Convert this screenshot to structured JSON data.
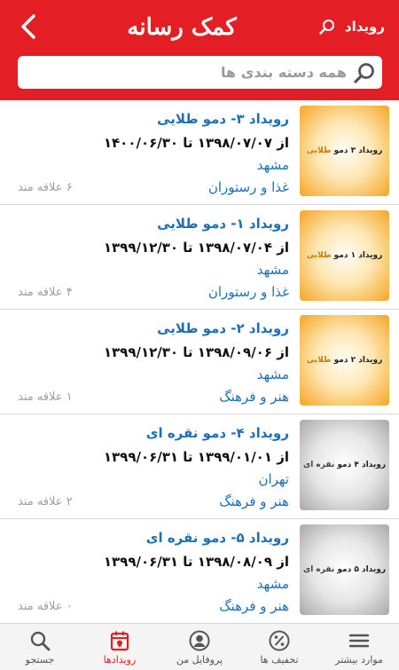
{
  "header": {
    "back_icon": "chevron-left-icon",
    "logo_text": "کمک رسانه",
    "title": "رویداد",
    "title_icon": "search-icon",
    "brand_color": "#e31e24"
  },
  "search": {
    "placeholder": "همه دسته بندی ها",
    "icon": "search-icon"
  },
  "events": [
    {
      "title": "رویداد ۳- دمو طلایی",
      "dates": "از ۱۳۹۸/۰۷/۰۷ تا ۱۴۰۰/۰۶/۳۰",
      "city": "مشهد",
      "category": "غذا و رستوران",
      "interested": "۶ علاقه مند",
      "thumb_name": "رویداد ۳ دمو",
      "thumb_tier": "طلایی",
      "thumb_style": "gold"
    },
    {
      "title": "رویداد ۱- دمو طلایی",
      "dates": "از ۱۳۹۸/۰۷/۰۴ تا ۱۳۹۹/۱۲/۳۰",
      "city": "مشهد",
      "category": "غذا و رستوران",
      "interested": "۴ علاقه مند",
      "thumb_name": "رویداد ۱ دمو",
      "thumb_tier": "طلایی",
      "thumb_style": "gold"
    },
    {
      "title": "رویداد ۲- دمو طلایی",
      "dates": "از ۱۳۹۸/۰۹/۰۶ تا ۱۳۹۹/۱۲/۳۰",
      "city": "مشهد",
      "category": "هنر و فرهنگ",
      "interested": "۱ علاقه مند",
      "thumb_name": "رویداد ۲ دمو",
      "thumb_tier": "طلایی",
      "thumb_style": "gold"
    },
    {
      "title": "رویداد ۴- دمو نقره ای",
      "dates": "از ۱۳۹۹/۰۱/۰۱ تا ۱۳۹۹/۰۶/۳۱",
      "city": "تهران",
      "category": "هنر و فرهنگ",
      "interested": "۲ علاقه مند",
      "thumb_name": "رویداد ۴ دمو",
      "thumb_tier": "نقره ای",
      "thumb_style": "silver"
    },
    {
      "title": "رویداد ۵- دمو نقره ای",
      "dates": "از ۱۳۹۸/۰۸/۰۹ تا ۱۳۹۹/۰۶/۳۱",
      "city": "مشهد",
      "category": "هنر و فرهنگ",
      "interested": "۰ علاقه مند",
      "thumb_name": "رویداد ۵ دمو",
      "thumb_tier": "نقره ای",
      "thumb_style": "silver"
    }
  ],
  "tabs": [
    {
      "label": "جستجو",
      "icon": "search-icon",
      "active": false
    },
    {
      "label": "رویدادها",
      "icon": "calendar-icon",
      "active": true
    },
    {
      "label": "پروفایل من",
      "icon": "profile-icon",
      "active": false
    },
    {
      "label": "تخفیف ها",
      "icon": "percent-icon",
      "active": false
    },
    {
      "label": "موارد بیشتر",
      "icon": "menu-icon",
      "active": false
    }
  ],
  "colors": {
    "accent": "#e31e24",
    "link": "#1f6fb5",
    "muted": "#9e9e9e"
  }
}
